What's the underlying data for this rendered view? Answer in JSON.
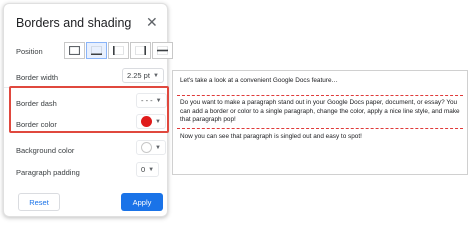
{
  "dialog": {
    "title": "Borders and shading",
    "close_icon": "close-icon",
    "position_label": "Position",
    "position_buttons": [
      "border-all",
      "border-bottom-selected",
      "border-left",
      "border-right",
      "border-between"
    ],
    "border_width_label": "Border width",
    "border_width_value": "2.25 pt",
    "border_dash_label": "Border dash",
    "border_dash_value": "- - -",
    "border_color_label": "Border color",
    "border_color": "#e01b1b",
    "background_color_label": "Background color",
    "background_color": "#ffffff",
    "paragraph_padding_label": "Paragraph padding",
    "paragraph_padding_value": "0",
    "reset_label": "Reset",
    "apply_label": "Apply"
  },
  "colors": {
    "accent": "#1a73e8",
    "highlight": "#e0483e",
    "dash": "#e03a3a"
  },
  "document": {
    "line1": "Let's take a look at a convenient Google Docs feature…",
    "para": "Do you want to make a paragraph stand out in your Google Docs paper, document, or essay? You can add a border or color to a single paragraph, change the color, apply a nice line style, and make that paragraph pop!",
    "line3": "Now you can see that paragraph is singled out and easy to spot!"
  }
}
